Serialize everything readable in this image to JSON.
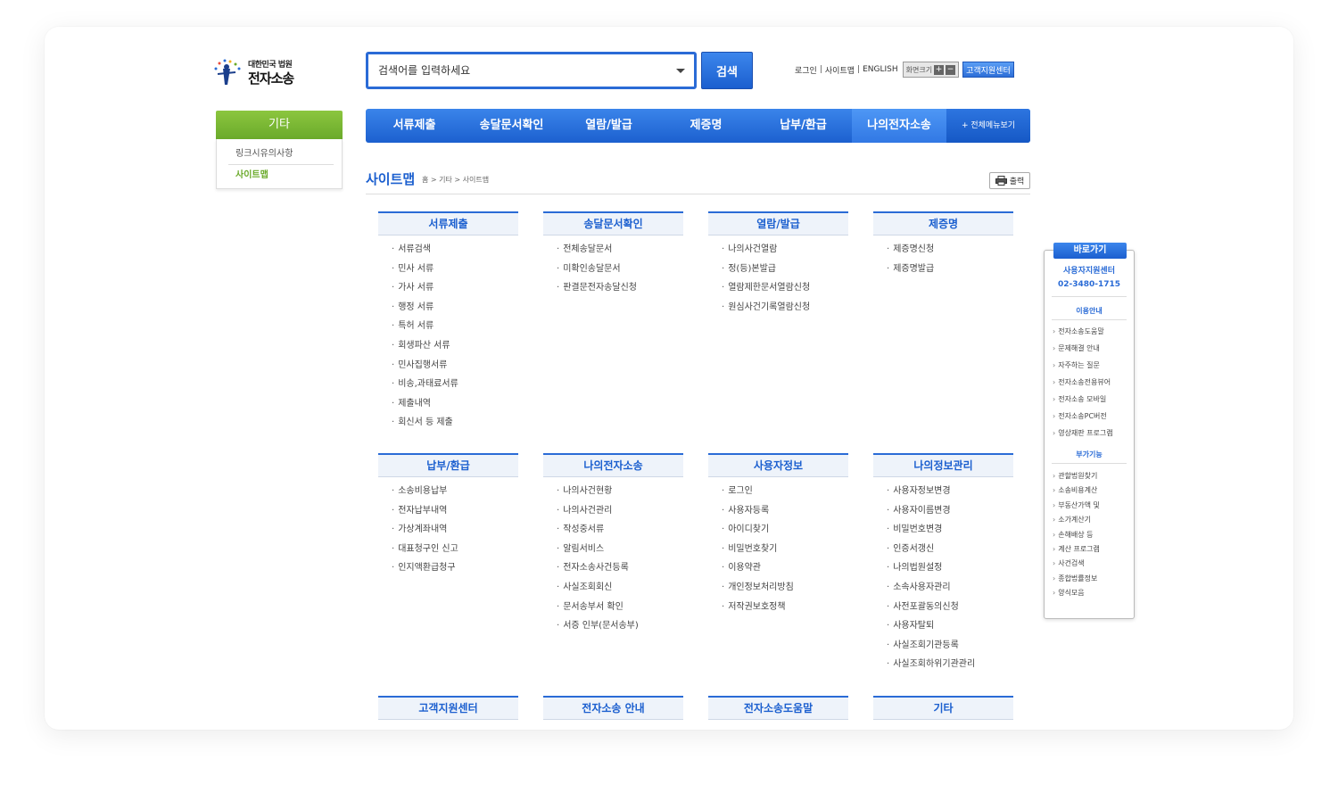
{
  "logo": {
    "small": "대한민국 법원",
    "big": "전자소송"
  },
  "search": {
    "placeholder": "검색어를 입력하세요",
    "button": "검색"
  },
  "util": {
    "login": "로그인",
    "sitemap": "사이트맵",
    "english": "ENGLISH",
    "fontsize": "화면크기",
    "plus": "+",
    "minus": "−",
    "customer_center": "고객지원센터"
  },
  "lnb": {
    "title": "기타",
    "items": [
      "링크시유의사항",
      "사이트맵"
    ]
  },
  "gnb": {
    "items": [
      "서류제출",
      "송달문서확인",
      "열람/발급",
      "제증명",
      "납부/환급",
      "나의전자소송"
    ],
    "all_menu": "+ 전체메뉴보기"
  },
  "page": {
    "title": "사이트맵",
    "breadcrumb": "홈 > 기타 > 사이트맵",
    "print": "출력"
  },
  "sitemap": [
    {
      "title": "서류제출",
      "items": [
        "서류검색",
        "민사 서류",
        "가사 서류",
        "행정 서류",
        "특허 서류",
        "회생파산 서류",
        "민사집행서류",
        "비송,과태료서류",
        "제출내역",
        "회신서 등 제출"
      ]
    },
    {
      "title": "송달문서확인",
      "items": [
        "전체송달문서",
        "미확인송달문서",
        "판결문전자송달신청"
      ]
    },
    {
      "title": "열람/발급",
      "items": [
        "나의사건열람",
        "정(등)본발급",
        "열람제한문서열람신청",
        "원심사건기록열람신청"
      ]
    },
    {
      "title": "제증명",
      "items": [
        "제증명신청",
        "제증명발급"
      ]
    },
    {
      "title": "납부/환급",
      "items": [
        "소송비용납부",
        "전자납부내역",
        "가상계좌내역",
        "대표청구인 신고",
        "인지액환급청구"
      ]
    },
    {
      "title": "나의전자소송",
      "items": [
        "나의사건현황",
        "나의사건관리",
        "작성중서류",
        "알림서비스",
        "전자소송사건등록",
        "사실조회회신",
        "문서송부서 확인",
        "서증 인부(문서송부)"
      ]
    },
    {
      "title": "사용자정보",
      "items": [
        "로그인",
        "사용자등록",
        "아이디찾기",
        "비밀번호찾기",
        "이용약관",
        "개인정보처리방침",
        "저작권보호정책"
      ]
    },
    {
      "title": "나의정보관리",
      "items": [
        "사용자정보변경",
        "사용자이름변경",
        "비밀번호변경",
        "인증서갱신",
        "나의법원설정",
        "소속사용자관리",
        "사전포괄동의신청",
        "사용자탈퇴",
        "사실조회기관등록",
        "사실조회하위기관관리"
      ]
    },
    {
      "title": "고객지원센터",
      "items": []
    },
    {
      "title": "전자소송 안내",
      "items": []
    },
    {
      "title": "전자소송도움말",
      "items": []
    },
    {
      "title": "기타",
      "items": []
    }
  ],
  "quick": {
    "title": "바로가기",
    "center_name": "사용자지원센터",
    "center_phone": "02-3480-1715",
    "sec1": "이용안내",
    "sec1_items": [
      "전자소송도움말",
      "문제해결 안내",
      "자주하는 질문",
      "전자소송전용뷰어",
      "전자소송 모바일",
      "전자소송PC버전",
      "영상재판 프로그램"
    ],
    "sec2": "부가기능",
    "sec2_items": [
      "관할법원찾기",
      "소송비용계산",
      "부동산가액 및",
      "소가계산기",
      "손해배상 등",
      "계산 프로그램",
      "사건검색",
      "종합법률정보",
      "양식모음"
    ]
  },
  "colors": {
    "brand_blue": "#1b5fcf",
    "green": "#6aaa2a"
  }
}
